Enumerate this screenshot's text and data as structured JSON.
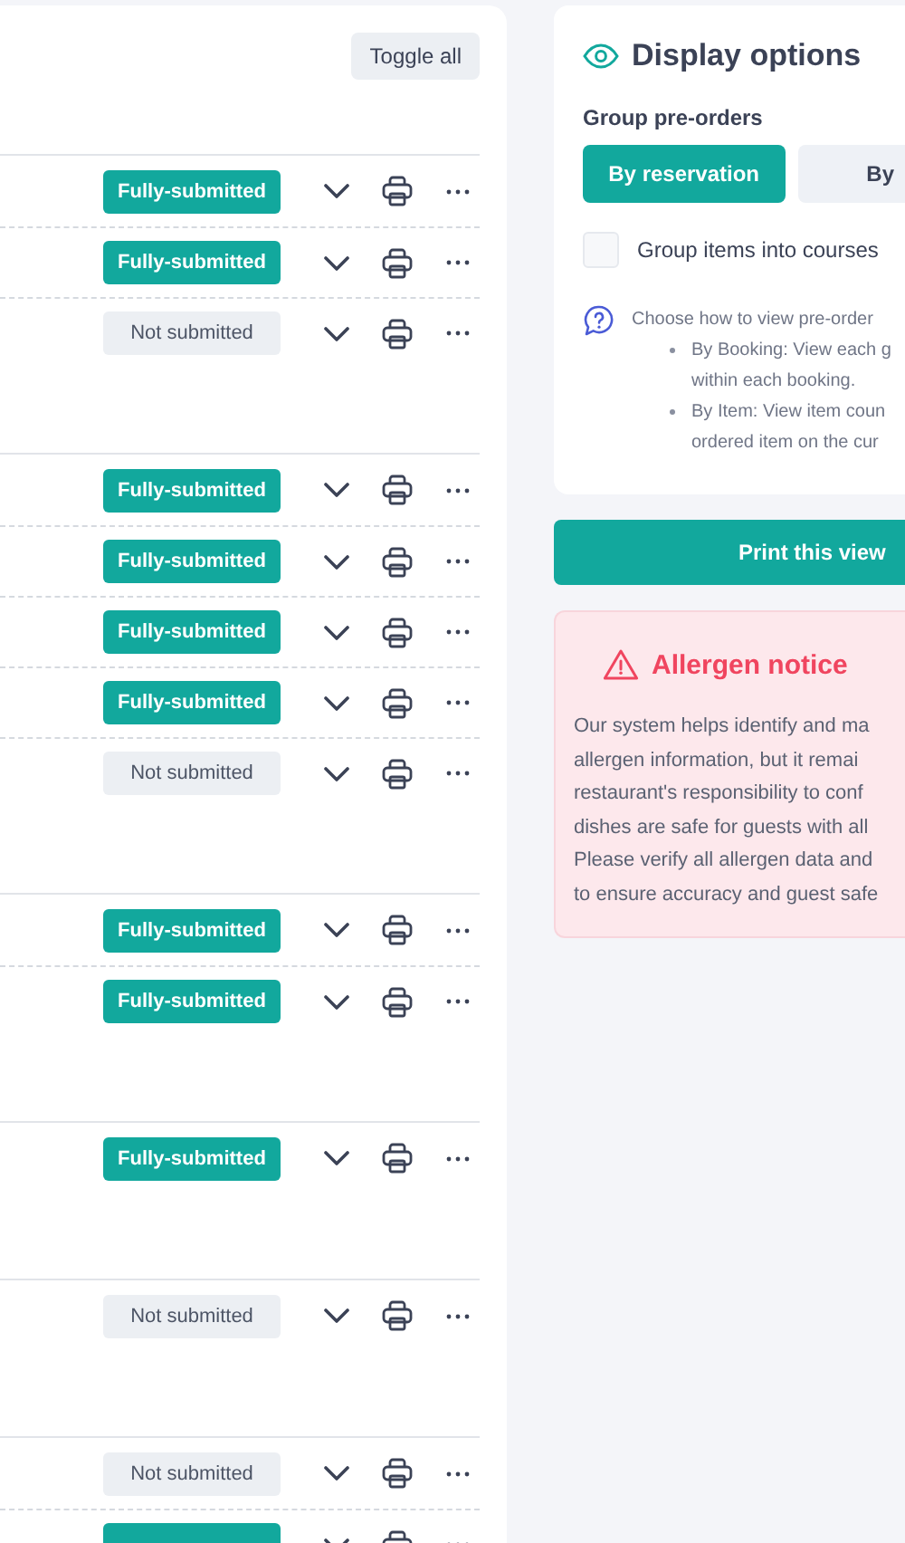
{
  "toggle_all": "Toggle all",
  "groups": [
    {
      "rows": [
        {
          "status": "Fully-submitted",
          "kind": "full"
        },
        {
          "status": "Fully-submitted",
          "kind": "full"
        },
        {
          "status": "Not submitted",
          "kind": "not"
        }
      ]
    },
    {
      "rows": [
        {
          "status": "Fully-submitted",
          "kind": "full"
        },
        {
          "status": "Fully-submitted",
          "kind": "full"
        },
        {
          "status": "Fully-submitted",
          "kind": "full"
        },
        {
          "status": "Fully-submitted",
          "kind": "full"
        },
        {
          "status": "Not submitted",
          "kind": "not"
        }
      ]
    },
    {
      "rows": [
        {
          "status": "Fully-submitted",
          "kind": "full"
        },
        {
          "status": "Fully-submitted",
          "kind": "full"
        }
      ]
    },
    {
      "rows": [
        {
          "status": "Fully-submitted",
          "kind": "full"
        }
      ]
    },
    {
      "rows": [
        {
          "status": "Not submitted",
          "kind": "not"
        }
      ]
    },
    {
      "rows": [
        {
          "status": "Not submitted",
          "kind": "not"
        },
        {
          "kind": "full"
        }
      ]
    }
  ],
  "display_options": {
    "title": "Display options",
    "group_label": "Group pre-orders",
    "group_options": [
      {
        "label": "By reservation",
        "selected": true
      },
      {
        "label": "By",
        "selected": false
      }
    ],
    "group_courses": {
      "label": "Group items into courses",
      "checked": false
    },
    "help": {
      "intro": "Choose how to view pre-order",
      "bullets": [
        {
          "lines": [
            "By Booking: View each g",
            "within each booking."
          ]
        },
        {
          "lines": [
            "By Item: View item coun",
            "ordered item on the cur"
          ]
        }
      ]
    }
  },
  "print_button": "Print this view",
  "allergen_notice": {
    "title": "Allergen notice",
    "lines": [
      "Our system helps identify and ma",
      "allergen information, but it remai",
      "restaurant's responsibility to conf",
      "dishes are safe for guests with all",
      "Please verify all allergen data and",
      "to ensure accuracy and guest safe"
    ]
  }
}
